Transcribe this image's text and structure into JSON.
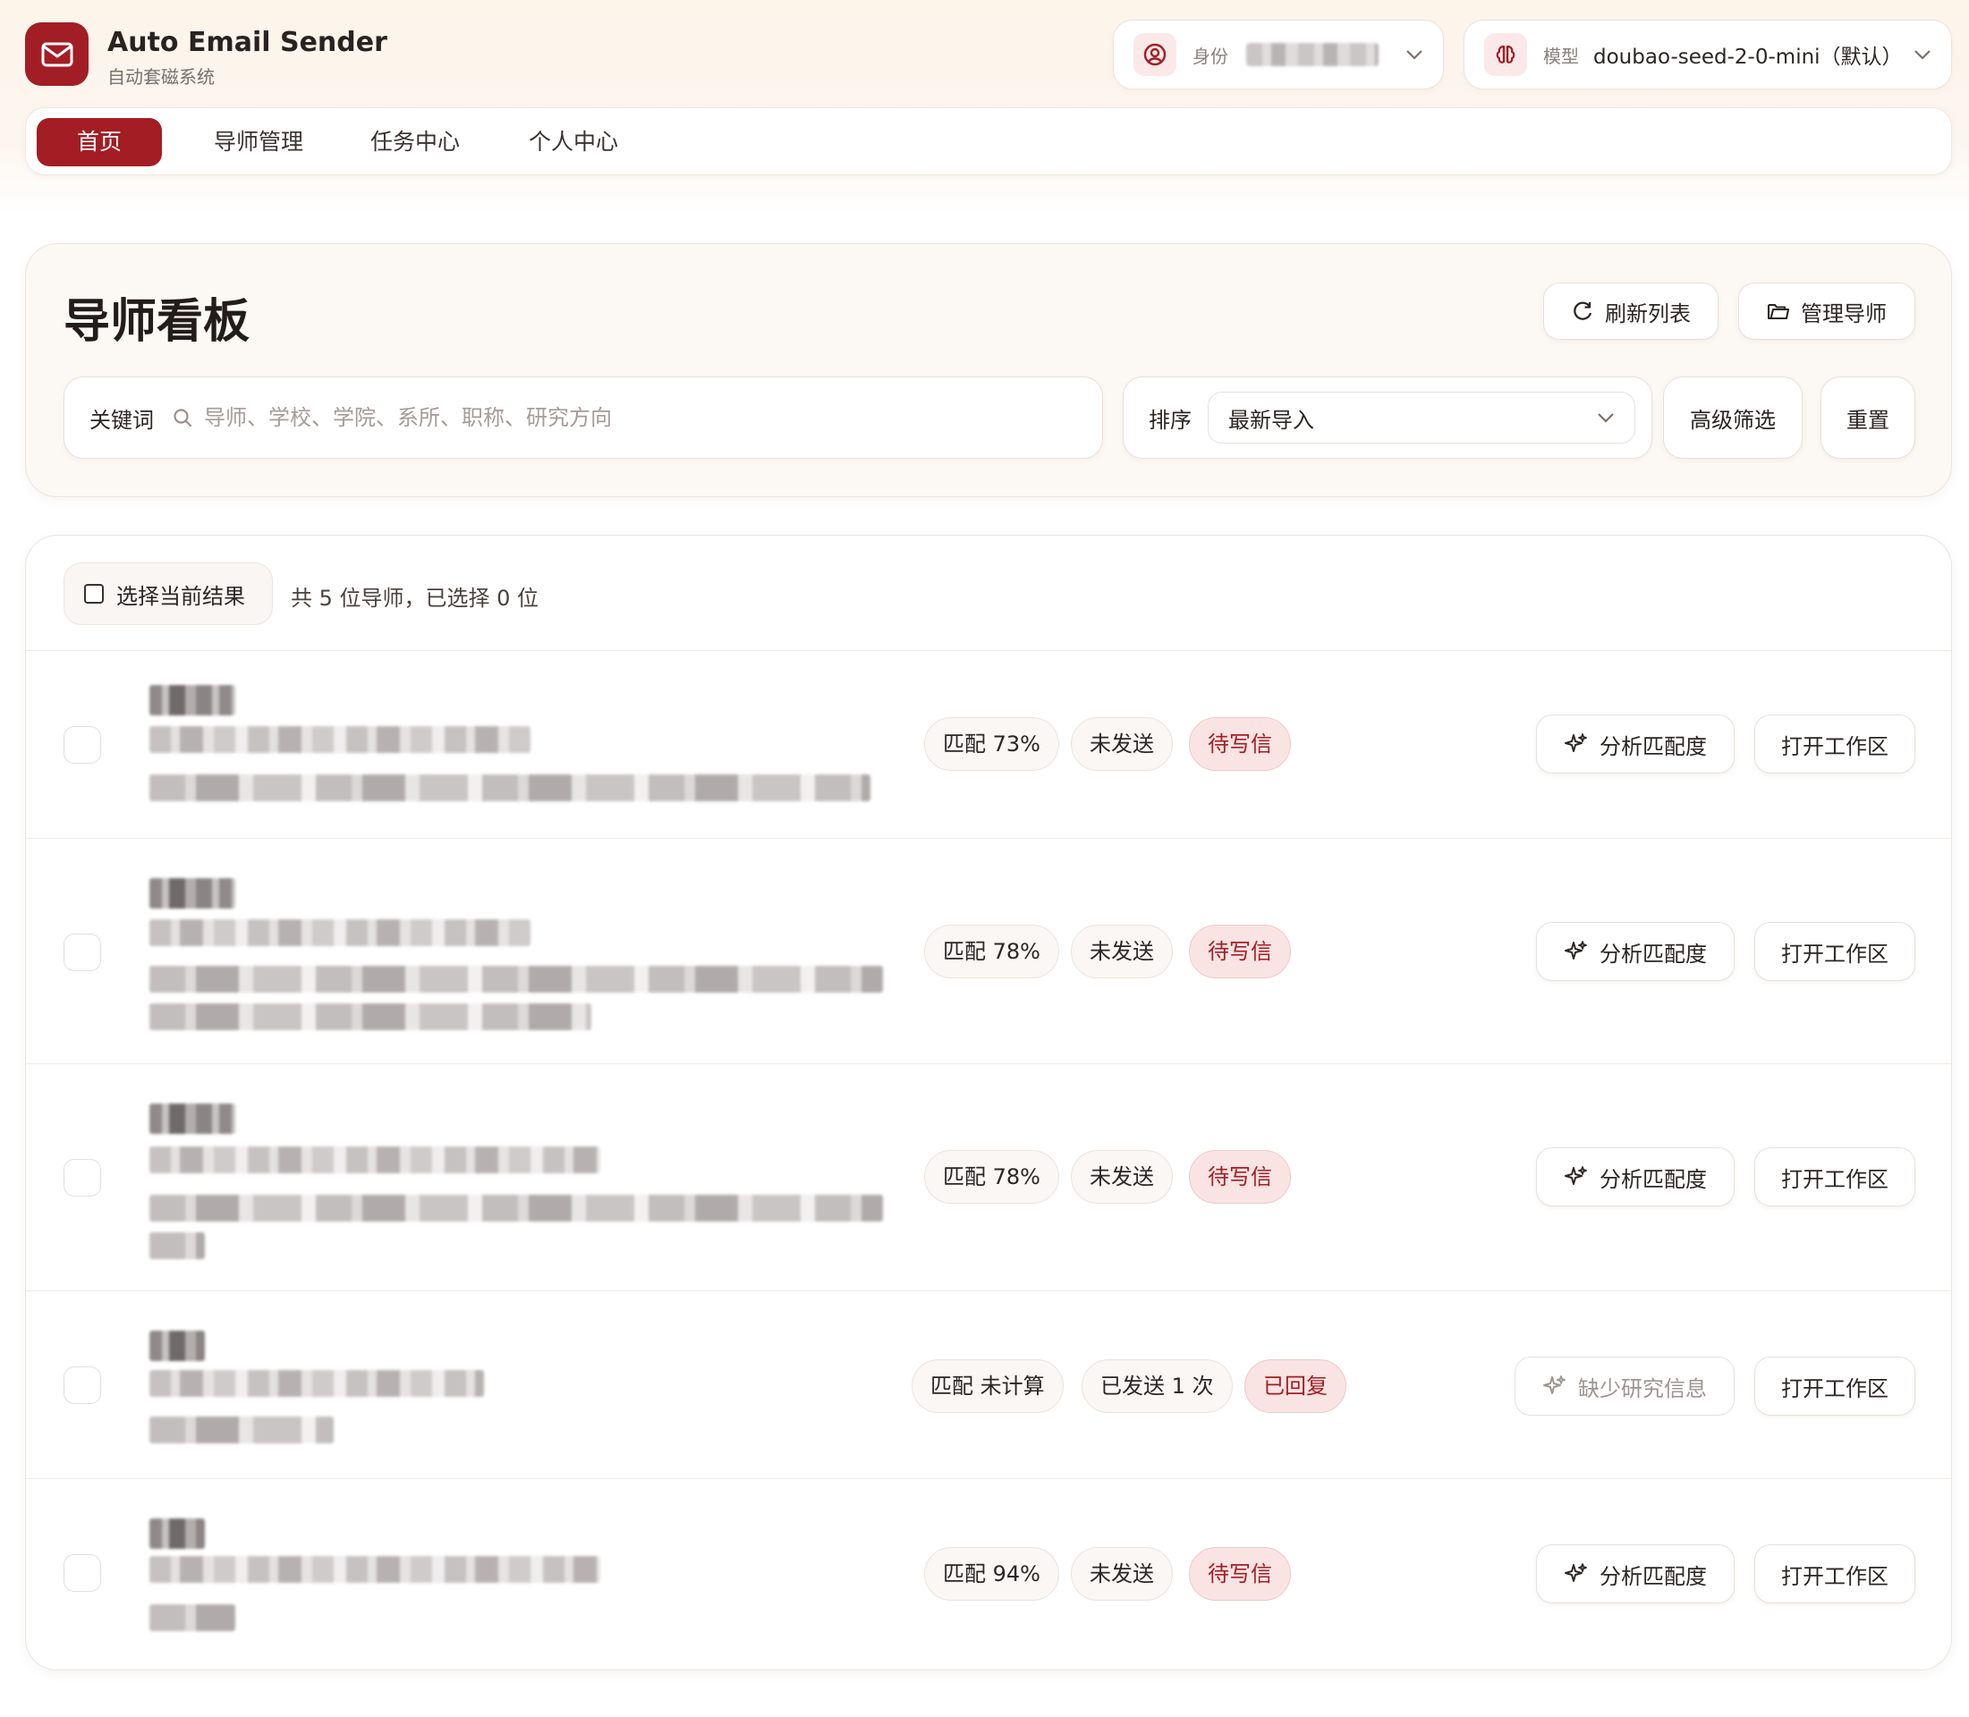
{
  "app": {
    "title": "Auto Email Sender",
    "subtitle": "自动套磁系统",
    "brand_color": "#a31d24"
  },
  "header": {
    "identity": {
      "icon": "user-circle-icon",
      "label": "身份",
      "value": ""
    },
    "model": {
      "icon": "brain-icon",
      "label": "模型",
      "value": "doubao-seed-2-0-mini（默认）"
    }
  },
  "nav": {
    "items": [
      {
        "label": "首页",
        "active": true
      },
      {
        "label": "导师管理",
        "active": false
      },
      {
        "label": "任务中心",
        "active": false
      },
      {
        "label": "个人中心",
        "active": false
      }
    ]
  },
  "board": {
    "title": "导师看板",
    "refresh_label": "刷新列表",
    "manage_label": "管理导师",
    "search": {
      "label": "关键词",
      "placeholder": "导师、学校、学院、系所、职称、研究方向",
      "value": ""
    },
    "sort": {
      "label": "排序",
      "selected": "最新导入"
    },
    "advanced_filter_label": "高级筛选",
    "reset_label": "重置"
  },
  "list": {
    "select_all_label": "选择当前结果",
    "count_text": "共 5 位导师，已选择 0 位",
    "rows": [
      {
        "match": "匹配 73%",
        "send_status": "未发送",
        "reply_status": "待写信",
        "analyze_label": "分析匹配度",
        "analyze_enabled": true,
        "open_label": "打开工作区"
      },
      {
        "match": "匹配 78%",
        "send_status": "未发送",
        "reply_status": "待写信",
        "analyze_label": "分析匹配度",
        "analyze_enabled": true,
        "open_label": "打开工作区"
      },
      {
        "match": "匹配 78%",
        "send_status": "未发送",
        "reply_status": "待写信",
        "analyze_label": "分析匹配度",
        "analyze_enabled": true,
        "open_label": "打开工作区"
      },
      {
        "match": "匹配 未计算",
        "send_status": "已发送 1 次",
        "reply_status": "已回复",
        "analyze_label": "缺少研究信息",
        "analyze_enabled": false,
        "open_label": "打开工作区"
      },
      {
        "match": "匹配 94%",
        "send_status": "未发送",
        "reply_status": "待写信",
        "analyze_label": "分析匹配度",
        "analyze_enabled": true,
        "open_label": "打开工作区"
      }
    ]
  }
}
